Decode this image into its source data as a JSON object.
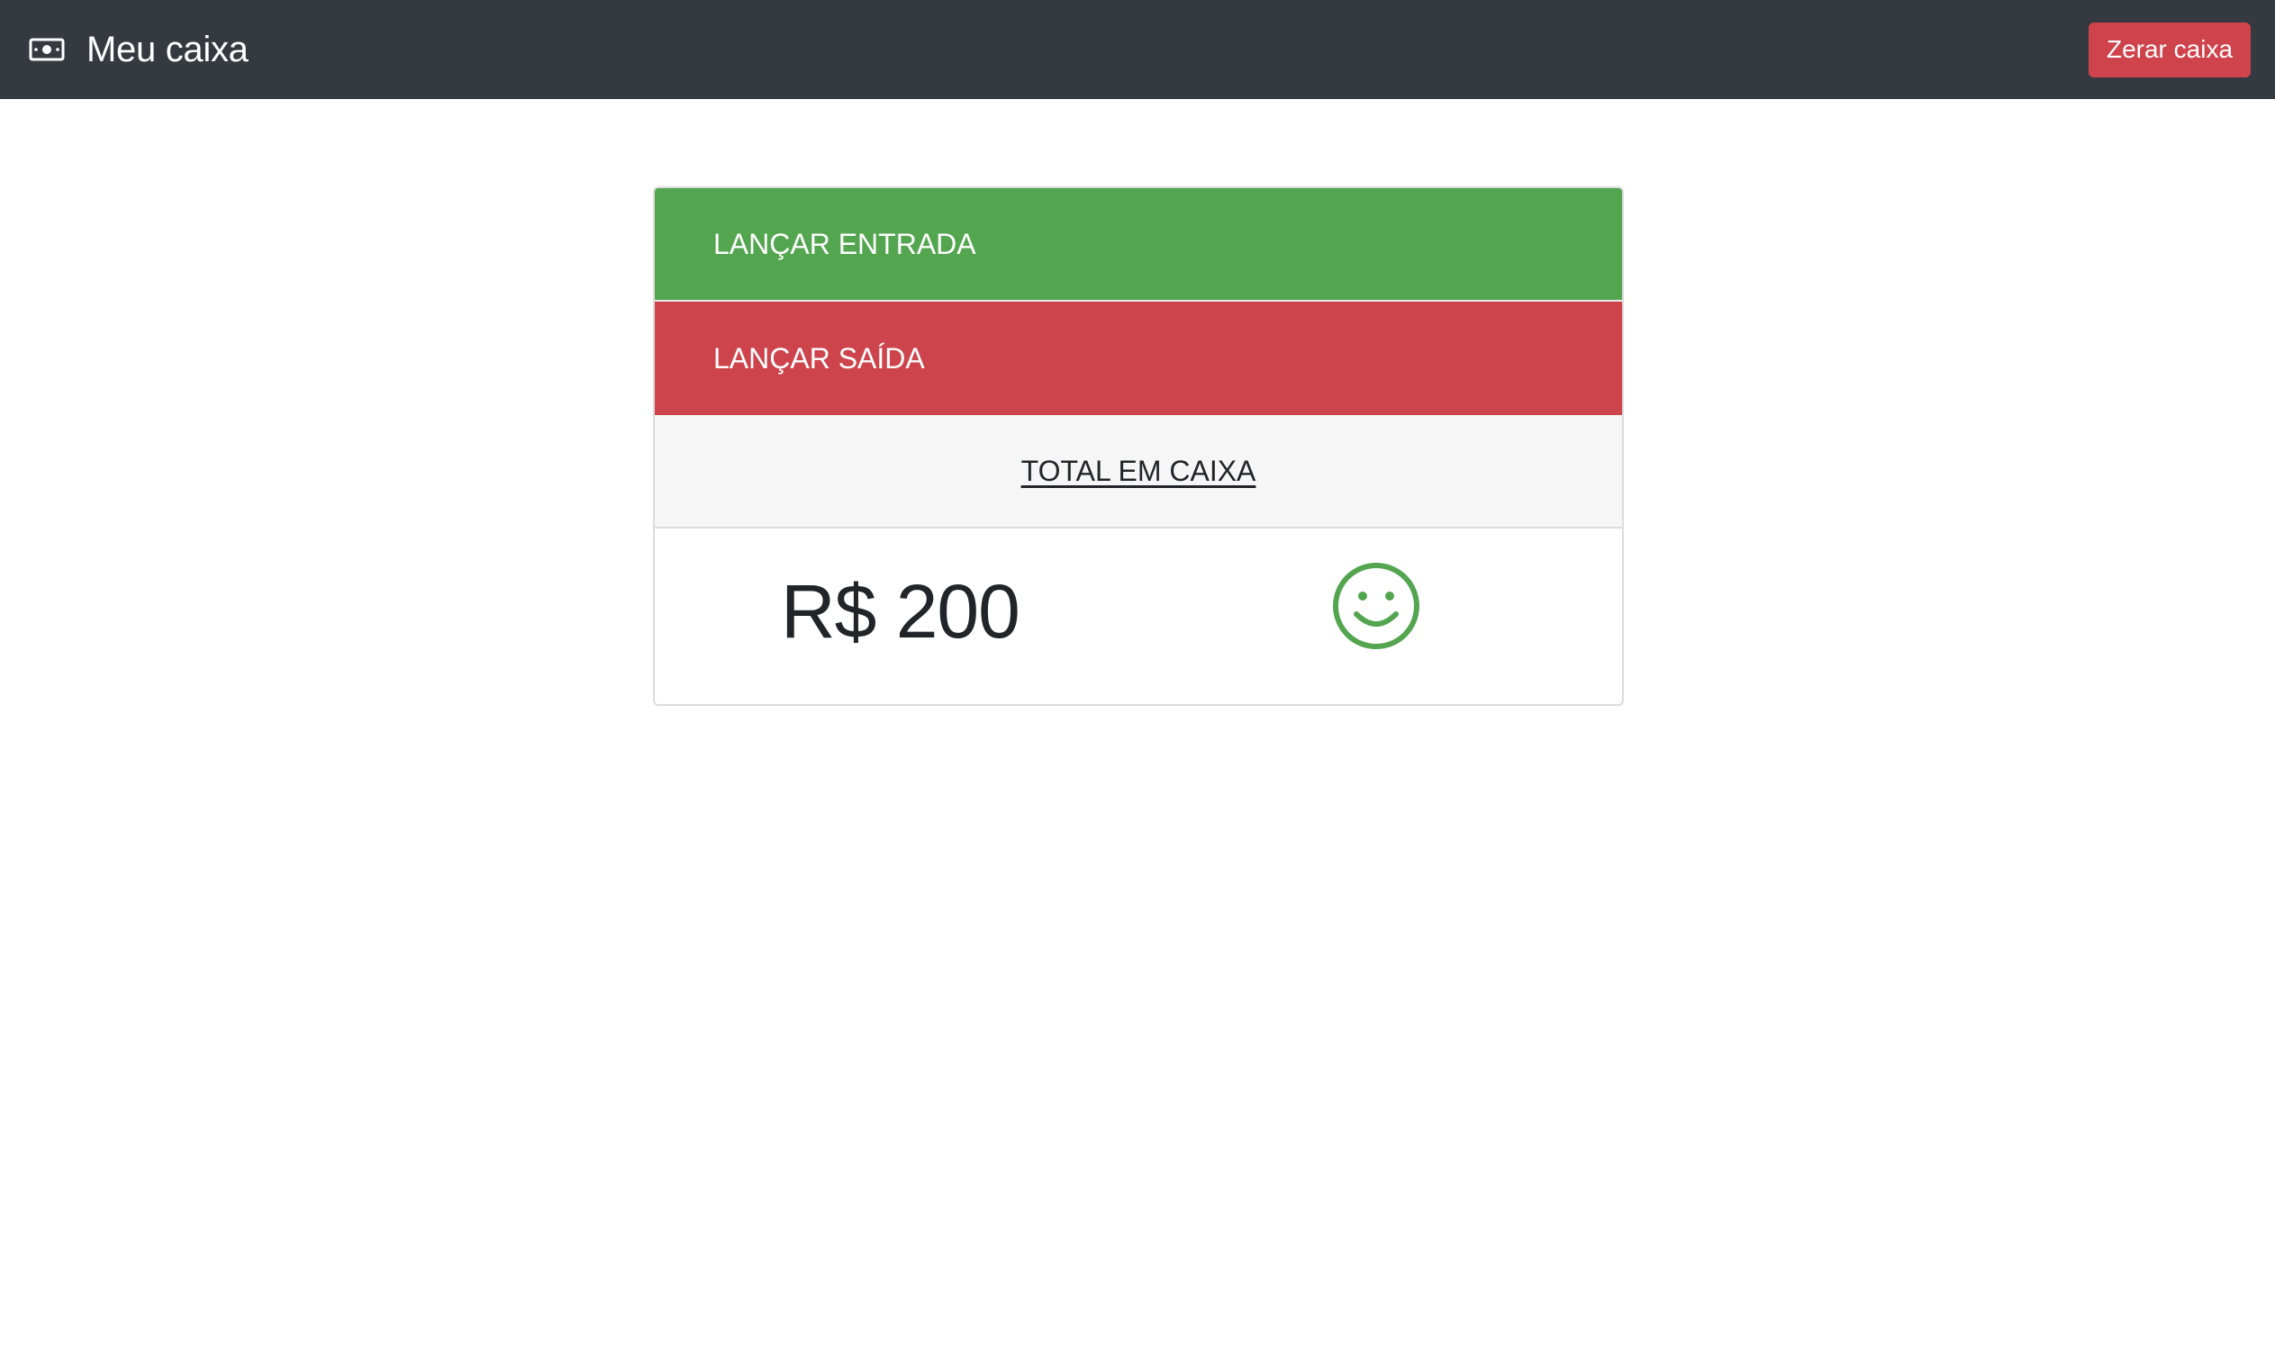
{
  "navbar": {
    "brand_icon": "money-bill-icon",
    "title": "Meu caixa",
    "reset_label": "Zerar caixa",
    "background_color": "#343a40",
    "reset_color": "#cf434c"
  },
  "card": {
    "entry_label": "LANÇAR ENTRADA",
    "entry_color": "#53a550",
    "exit_label": "LANÇAR SAÍDA",
    "exit_color": "#cd444c",
    "total_label": "TOTAL EM CAIXA",
    "total_amount": "R$ 200",
    "status_icon": "smile-icon",
    "status_color": "#53a550"
  }
}
